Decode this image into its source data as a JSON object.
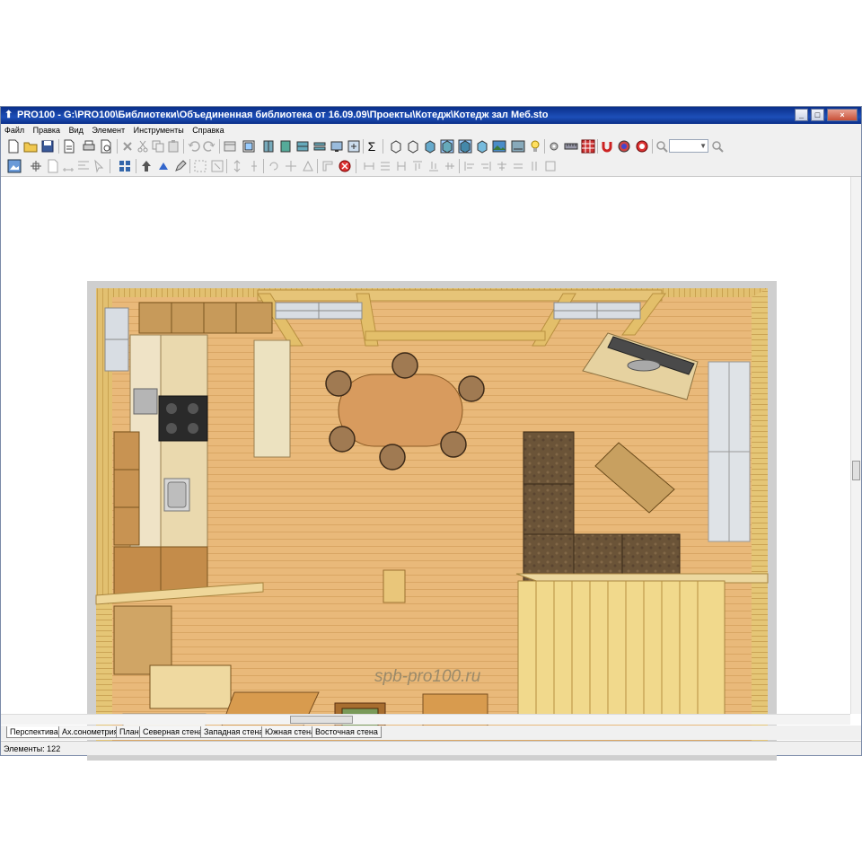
{
  "window": {
    "title": "PRO100 - G:\\PRO100\\Библиотеки\\Объединенная библиотека от 16.09.09\\Проекты\\Котедж\\Котедж зал Меб.sto",
    "controls": {
      "minimize": "_",
      "maximize": "□",
      "close": "×"
    }
  },
  "menu": {
    "items": [
      "Файл",
      "Правка",
      "Вид",
      "Элемент",
      "Инструменты",
      "Справка"
    ]
  },
  "toolbar": {
    "zoom_value": "",
    "sigma_label": "Σ"
  },
  "canvas": {
    "watermark": "spb-pro100.ru"
  },
  "tabs": [
    "Перспектива",
    "Ах.сонометрия",
    "План",
    "Северная стена",
    "Западная стена",
    "Южная стена",
    "Восточная стена"
  ],
  "active_tab": "Перспектива",
  "status": {
    "text": "Элементы: 122"
  },
  "colors": {
    "title_bar": "#1d4fb8",
    "floor": "#e8b97a",
    "wall": "#d9b56a",
    "sofa": "#6b5438",
    "table": "#d8a060"
  }
}
